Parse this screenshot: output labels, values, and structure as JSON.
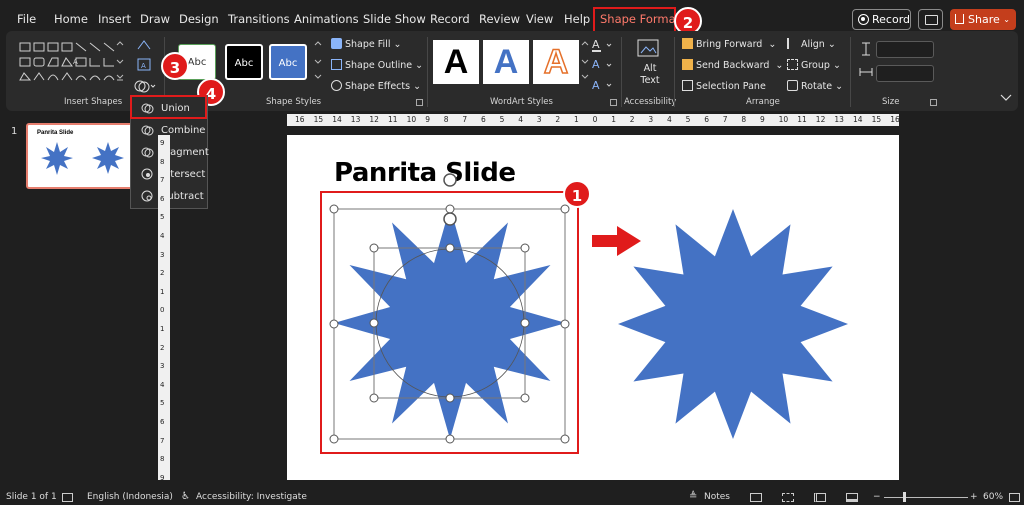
{
  "tabs": [
    "File",
    "Home",
    "Insert",
    "Draw",
    "Design",
    "Transitions",
    "Animations",
    "Slide Show",
    "Record",
    "Review",
    "View",
    "Help",
    "Shape Format"
  ],
  "active_tab": "Shape Format",
  "titlebar": {
    "record_label": "Record",
    "share_label": "Share"
  },
  "ribbon": {
    "groups": {
      "insert_shapes": "Insert Shapes",
      "shape_styles": "Shape Styles",
      "wordart_styles": "WordArt Styles",
      "accessibility": "Accessibility",
      "arrange": "Arrange",
      "size": "Size"
    },
    "style_swatches": [
      "Abc",
      "Abc",
      "Abc"
    ],
    "shape_fill": "Shape Fill",
    "shape_outline": "Shape Outline",
    "shape_effects": "Shape Effects",
    "wordart_letters": [
      "A",
      "A",
      "A"
    ],
    "alt_text_line1": "Alt",
    "alt_text_line2": "Text",
    "bring_forward": "Bring Forward",
    "send_backward": "Send Backward",
    "selection_pane": "Selection Pane",
    "align": "Align",
    "group": "Group",
    "rotate": "Rotate"
  },
  "merge_menu": {
    "items": [
      "Union",
      "Combine",
      "Fragment",
      "Intersect",
      "Subtract"
    ],
    "highlighted": "Union"
  },
  "annotations": [
    "1",
    "2",
    "3",
    "4"
  ],
  "thumbnail": {
    "number": "1",
    "title": "Panrita Slide"
  },
  "slide": {
    "title": "Panrita Slide"
  },
  "ruler": {
    "top": [
      "16",
      "15",
      "14",
      "13",
      "12",
      "11",
      "10",
      "9",
      "8",
      "7",
      "6",
      "5",
      "4",
      "3",
      "2",
      "1",
      "0",
      "1",
      "2",
      "3",
      "4",
      "5",
      "6",
      "7",
      "8",
      "9",
      "10",
      "11",
      "12",
      "13",
      "14",
      "15",
      "16"
    ],
    "left": [
      "9",
      "8",
      "7",
      "6",
      "5",
      "4",
      "3",
      "2",
      "1",
      "0",
      "1",
      "2",
      "3",
      "4",
      "5",
      "6",
      "7",
      "8",
      "9"
    ]
  },
  "status": {
    "slide_info": "Slide 1 of 1",
    "language": "English (Indonesia)",
    "accessibility": "Accessibility: Investigate",
    "notes": "Notes",
    "zoom": "60%"
  },
  "colors": {
    "accent": "#c43e1c",
    "annotation": "#e01b1b",
    "shape_fill": "#4472c4"
  }
}
